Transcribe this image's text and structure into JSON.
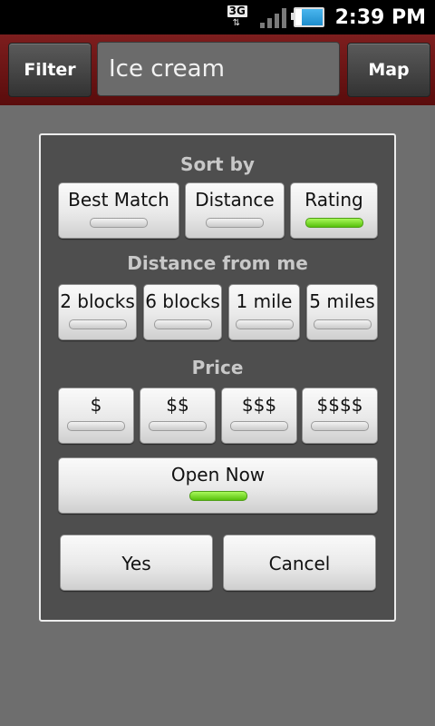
{
  "status_bar": {
    "network": "3G",
    "time": "2:39 PM"
  },
  "top_bar": {
    "filter_label": "Filter",
    "search_value": "Ice cream",
    "map_label": "Map"
  },
  "dialog": {
    "sort_by": {
      "title": "Sort by",
      "options": [
        {
          "label": "Best Match",
          "selected": false
        },
        {
          "label": "Distance",
          "selected": false
        },
        {
          "label": "Rating",
          "selected": true
        }
      ]
    },
    "distance": {
      "title": "Distance from me",
      "options": [
        {
          "label": "2 blocks",
          "selected": false
        },
        {
          "label": "6 blocks",
          "selected": false
        },
        {
          "label": "1 mile",
          "selected": false
        },
        {
          "label": "5 miles",
          "selected": false
        }
      ]
    },
    "price": {
      "title": "Price",
      "options": [
        {
          "label": "$",
          "selected": false
        },
        {
          "label": "$$",
          "selected": false
        },
        {
          "label": "$$$",
          "selected": false
        },
        {
          "label": "$$$$",
          "selected": false
        }
      ]
    },
    "open_now": {
      "label": "Open Now",
      "selected": true
    },
    "yes_label": "Yes",
    "cancel_label": "Cancel"
  },
  "colors": {
    "indicator_on": "#7ede2e",
    "action_bar": "#6b1414"
  }
}
